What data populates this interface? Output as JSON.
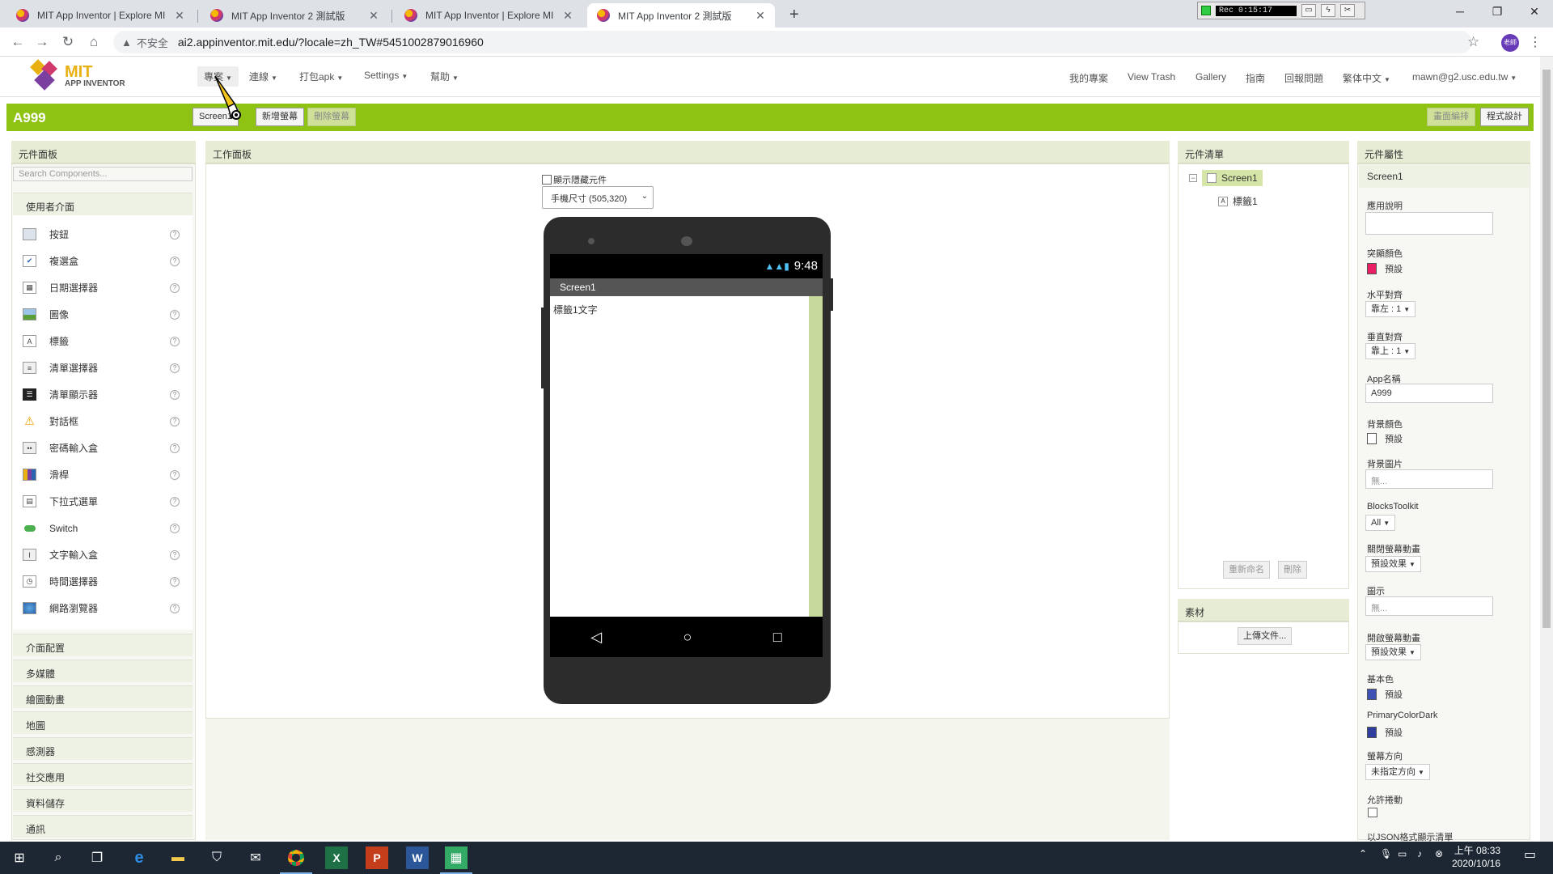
{
  "browser": {
    "tabs": [
      {
        "title": "MIT App Inventor | Explore MI"
      },
      {
        "title": "MIT App Inventor 2 測試版"
      },
      {
        "title": "MIT App Inventor | Explore MI"
      },
      {
        "title": "MIT App Inventor 2 測試版"
      }
    ],
    "recorder_time": "Rec 0:15:17",
    "insecure_label": "不安全",
    "url": "ai2.appinventor.mit.edu/?locale=zh_TW#5451002879016960",
    "profile_label": "老師"
  },
  "app": {
    "logo_title": "MIT",
    "logo_subtitle": "APP INVENTOR",
    "menus": [
      "專案",
      "連線",
      "打包apk",
      "Settings",
      "幫助"
    ],
    "right_links": [
      "我的專案",
      "View Trash",
      "Gallery",
      "指南",
      "回報問題",
      "繁体中文",
      "mawn@g2.usc.edu.tw"
    ]
  },
  "project": {
    "name": "A999",
    "screen_button": "Screen1",
    "add_screen": "新增螢幕",
    "remove_screen": "刪除螢幕",
    "designer_btn": "畫面編排",
    "blocks_btn": "程式設計"
  },
  "palette": {
    "header": "元件面板",
    "search_placeholder": "Search Components...",
    "ui_category": "使用者介面",
    "components": [
      {
        "label": "按鈕",
        "icon": "button-icon"
      },
      {
        "label": "複選盒",
        "icon": "checkbox-icon"
      },
      {
        "label": "日期選擇器",
        "icon": "datepicker-icon"
      },
      {
        "label": "圖像",
        "icon": "image-icon"
      },
      {
        "label": "標籤",
        "icon": "label-icon"
      },
      {
        "label": "清單選擇器",
        "icon": "listpicker-icon"
      },
      {
        "label": "清單顯示器",
        "icon": "listview-icon"
      },
      {
        "label": "對話框",
        "icon": "notifier-icon"
      },
      {
        "label": "密碼輸入盒",
        "icon": "password-icon"
      },
      {
        "label": "滑桿",
        "icon": "slider-icon"
      },
      {
        "label": "下拉式選單",
        "icon": "spinner-icon"
      },
      {
        "label": "Switch",
        "icon": "switch-icon"
      },
      {
        "label": "文字輸入盒",
        "icon": "textbox-icon"
      },
      {
        "label": "時間選擇器",
        "icon": "timepicker-icon"
      },
      {
        "label": "網路瀏覽器",
        "icon": "webviewer-icon"
      }
    ],
    "categories": [
      "介面配置",
      "多媒體",
      "繪圖動畫",
      "地圖",
      "感測器",
      "社交應用",
      "資料儲存",
      "通訊"
    ]
  },
  "viewer": {
    "header": "工作面板",
    "show_hidden": "顯示隱藏元件",
    "size_option": "手機尺寸 (505,320)",
    "status_time": "9:48",
    "screen_title": "Screen1",
    "label_text": "標籤1文字"
  },
  "tree": {
    "header": "元件清單",
    "root": "Screen1",
    "child": "標籤1",
    "rename_btn": "重新命名",
    "delete_btn": "刪除",
    "media_header": "素材",
    "upload_btn": "上傳文件..."
  },
  "properties": {
    "header": "元件屬性",
    "component": "Screen1",
    "about_label": "應用說明",
    "accent_label": "突顯顏色",
    "accent_value": "預設",
    "accent_color": "#e91e63",
    "halign_label": "水平對齊",
    "halign_value": "靠左 : 1",
    "valign_label": "垂直對齊",
    "valign_value": "靠上 : 1",
    "appname_label": "App名稱",
    "appname_value": "A999",
    "bg_label": "背景顏色",
    "bg_value": "預設",
    "bgimg_label": "背景圖片",
    "bgimg_value": "無...",
    "blocks_label": "BlocksToolkit",
    "blocks_value": "All",
    "close_anim_label": "關閉螢幕動畫",
    "close_anim_value": "預設效果",
    "icon_label": "圖示",
    "icon_value": "無...",
    "open_anim_label": "開啟螢幕動畫",
    "open_anim_value": "預設效果",
    "primary_label": "基本色",
    "primary_value": "預設",
    "primary_color": "#3f51b5",
    "primary_dark_label": "PrimaryColorDark",
    "primary_dark_value": "預設",
    "primary_dark_color": "#303f9f",
    "orient_label": "螢幕方向",
    "orient_value": "未指定方向",
    "scroll_label": "允許捲動",
    "json_label": "以JSON格式顯示清單"
  },
  "taskbar": {
    "time": "上午 08:33",
    "date": "2020/10/16"
  }
}
